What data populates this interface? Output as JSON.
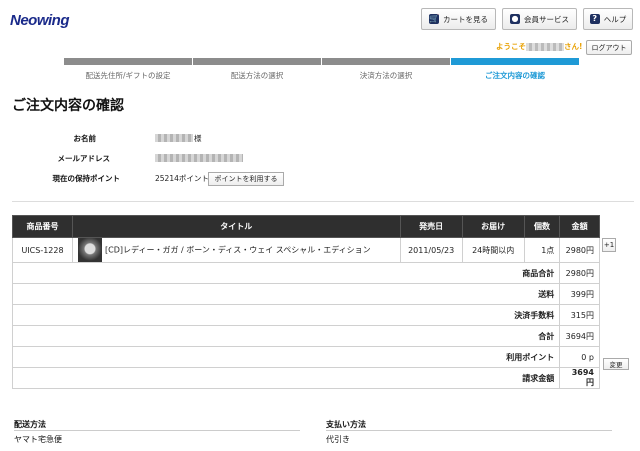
{
  "header": {
    "logo_text": "Neowing",
    "cart_label": "カートを見る",
    "member_label": "会員サービス",
    "help_label": "ヘルプ",
    "welcome_prefix": "ようこそ",
    "welcome_suffix": "さん!",
    "logout_label": "ログアウト"
  },
  "steps": [
    {
      "label": "配送先住所/ギフトの設定",
      "state": "done"
    },
    {
      "label": "配送方法の選択",
      "state": "done"
    },
    {
      "label": "決済方法の選択",
      "state": "done"
    },
    {
      "label": "ご注文内容の確認",
      "state": "current"
    }
  ],
  "colors": {
    "step_done": "#8c8c8c",
    "step_current": "#1f9ad6",
    "accent": "#e8a000"
  },
  "page_title": "ご注文内容の確認",
  "customer": {
    "name_label": "お名前",
    "name_suffix": "様",
    "email_label": "メールアドレス",
    "points_label": "現在の保持ポイント",
    "points_value": "25214ポイント",
    "use_points_button": "ポイントを利用する"
  },
  "table": {
    "headers": [
      "商品番号",
      "タイトル",
      "発売日",
      "お届け",
      "個数",
      "金額"
    ],
    "item": {
      "code": "UICS-1228",
      "title": "[CD]レディー・ガガ / ボーン・ディス・ウェイ スペシャル・エディション",
      "release": "2011/05/23",
      "delivery": "24時間以内",
      "qty": "1点",
      "price": "2980円",
      "plus_button": "+1"
    },
    "summary": [
      {
        "label": "商品合計",
        "value": "2980円"
      },
      {
        "label": "送料",
        "value": "399円"
      },
      {
        "label": "決済手数料",
        "value": "315円"
      },
      {
        "label": "合計",
        "value": "3694円"
      },
      {
        "label": "利用ポイント",
        "value": "0 p"
      },
      {
        "label": "請求金額",
        "value": "3694円"
      }
    ],
    "change_button": "変更"
  },
  "delivery": {
    "label": "配送方法",
    "value": "ヤマト宅急便"
  },
  "payment": {
    "label": "支払い方法",
    "value": "代引き"
  }
}
